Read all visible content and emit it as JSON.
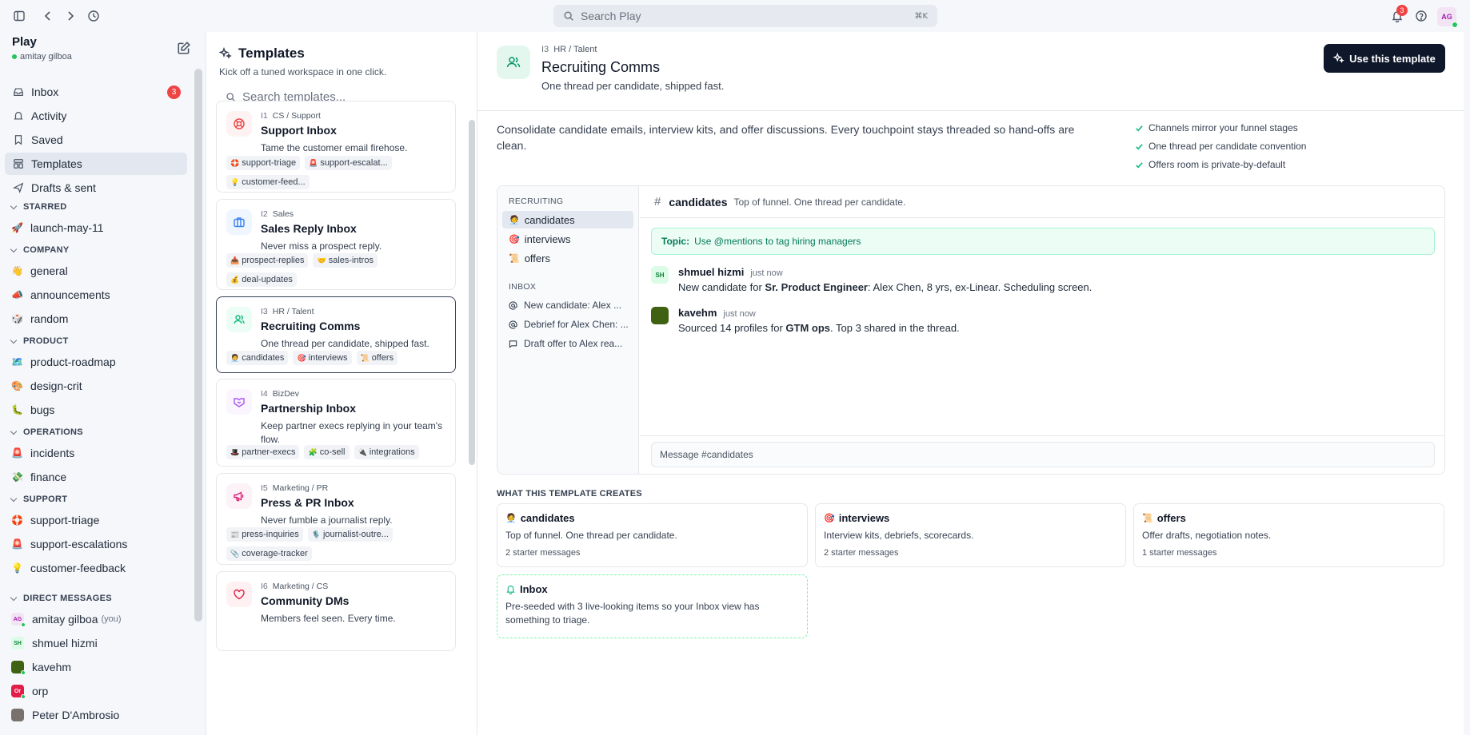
{
  "topbar": {
    "search_placeholder": "Search Play",
    "search_shortcut": "⌘K",
    "notification_count": "3",
    "user_initials": "AG"
  },
  "sidebar": {
    "workspace": "Play",
    "user": "amitay gilboa",
    "nav": [
      {
        "label": "Inbox",
        "icon": "inbox-icon",
        "badge": "3"
      },
      {
        "label": "Activity",
        "icon": "activity-icon"
      },
      {
        "label": "Saved",
        "icon": "bookmark-icon"
      },
      {
        "label": "Templates",
        "icon": "templates-icon"
      },
      {
        "label": "Drafts & sent",
        "icon": "send-icon"
      }
    ],
    "sections": [
      {
        "title": "STARRED",
        "channels": [
          {
            "emoji": "🚀",
            "name": "launch-may-11"
          }
        ]
      },
      {
        "title": "COMPANY",
        "channels": [
          {
            "emoji": "👋",
            "name": "general"
          },
          {
            "emoji": "📣",
            "name": "announcements"
          },
          {
            "emoji": "🎲",
            "name": "random"
          }
        ]
      },
      {
        "title": "PRODUCT",
        "channels": [
          {
            "emoji": "🗺️",
            "name": "product-roadmap"
          },
          {
            "emoji": "🎨",
            "name": "design-crit"
          },
          {
            "emoji": "🐛",
            "name": "bugs"
          }
        ]
      },
      {
        "title": "OPERATIONS",
        "channels": [
          {
            "emoji": "🚨",
            "name": "incidents"
          },
          {
            "emoji": "💸",
            "name": "finance"
          }
        ]
      },
      {
        "title": "SUPPORT",
        "channels": [
          {
            "emoji": "🛟",
            "name": "support-triage"
          },
          {
            "emoji": "🚨",
            "name": "support-escalations"
          },
          {
            "emoji": "💡",
            "name": "customer-feedback"
          }
        ]
      }
    ],
    "dm_title": "DIRECT MESSAGES",
    "dms": [
      {
        "initials": "AG",
        "name": "amitay gilboa",
        "suffix": "(you)",
        "bg": "#f3e4f4",
        "fg": "#a21caf"
      },
      {
        "initials": "SH",
        "name": "shmuel hizmi",
        "suffix": "",
        "bg": "#dcfce7",
        "fg": "#15803d"
      },
      {
        "initials": "",
        "name": "kavehm",
        "suffix": "",
        "bg": "#3f6212",
        "fg": "#fff"
      },
      {
        "initials": "Or",
        "name": "orp",
        "suffix": "",
        "bg": "#e11d48",
        "fg": "#fff"
      },
      {
        "initials": "",
        "name": "Peter D'Ambrosio",
        "suffix": "",
        "bg": "#78716c",
        "fg": "#fff"
      }
    ]
  },
  "templates": {
    "title": "Templates",
    "subtitle": "Kick off a tuned workspace in one click.",
    "search_placeholder": "Search templates...",
    "cards": [
      {
        "num": "I1",
        "cat": "CS / Support",
        "title": "Support Inbox",
        "desc": "Tame the customer email firehose.",
        "icon": "lifebuoy-icon",
        "accent": "#ef4444",
        "tint": "#fef2f2",
        "chips": [
          {
            "e": "🛟",
            "t": "support-triage"
          },
          {
            "e": "🚨",
            "t": "support-escalat..."
          },
          {
            "e": "💡",
            "t": "customer-feed..."
          }
        ]
      },
      {
        "num": "I2",
        "cat": "Sales",
        "title": "Sales Reply Inbox",
        "desc": "Never miss a prospect reply.",
        "icon": "briefcase-icon",
        "accent": "#3b82f6",
        "tint": "#eff6ff",
        "chips": [
          {
            "e": "📥",
            "t": "prospect-replies"
          },
          {
            "e": "🤝",
            "t": "sales-intros"
          },
          {
            "e": "💰",
            "t": "deal-updates"
          }
        ]
      },
      {
        "num": "I3",
        "cat": "HR / Talent",
        "title": "Recruiting Comms",
        "desc": "One thread per candidate, shipped fast.",
        "icon": "users-icon",
        "accent": "#10b981",
        "tint": "#ecfdf5",
        "chips": [
          {
            "e": "🧑‍💼",
            "t": "candidates"
          },
          {
            "e": "🎯",
            "t": "interviews"
          },
          {
            "e": "📜",
            "t": "offers"
          }
        ]
      },
      {
        "num": "I4",
        "cat": "BizDev",
        "title": "Partnership Inbox",
        "desc": "Keep partner execs replying in your team's flow.",
        "icon": "handshake-icon",
        "accent": "#a855f7",
        "tint": "#faf5ff",
        "chips": [
          {
            "e": "🎩",
            "t": "partner-execs"
          },
          {
            "e": "🧩",
            "t": "co-sell"
          },
          {
            "e": "🔌",
            "t": "integrations"
          }
        ]
      },
      {
        "num": "I5",
        "cat": "Marketing / PR",
        "title": "Press & PR Inbox",
        "desc": "Never fumble a journalist reply.",
        "icon": "megaphone-icon",
        "accent": "#db2777",
        "tint": "#fdf2f8",
        "chips": [
          {
            "e": "📰",
            "t": "press-inquiries"
          },
          {
            "e": "🎙️",
            "t": "journalist-outre..."
          },
          {
            "e": "📎",
            "t": "coverage-tracker"
          }
        ]
      },
      {
        "num": "I6",
        "cat": "Marketing / CS",
        "title": "Community DMs",
        "desc": "Members feel seen. Every time.",
        "icon": "heart-icon",
        "accent": "#e11d48",
        "tint": "#fff1f2",
        "chips": []
      }
    ]
  },
  "detail": {
    "num": "I3",
    "category": "HR / Talent",
    "title": "Recruiting Comms",
    "subtitle": "One thread per candidate, shipped fast.",
    "use_button": "Use this template",
    "description": "Consolidate candidate emails, interview kits, and offer discussions. Every touchpoint stays threaded so hand-offs are clean.",
    "checks": [
      "Channels mirror your funnel stages",
      "One thread per candidate convention",
      "Offers room is private-by-default"
    ],
    "preview": {
      "sec1": "RECRUITING",
      "channels": [
        {
          "e": "🧑‍💼",
          "t": "candidates"
        },
        {
          "e": "🎯",
          "t": "interviews"
        },
        {
          "e": "📜",
          "t": "offers"
        }
      ],
      "sec2": "INBOX",
      "inbox": [
        "New candidate: Alex ...",
        "Debrief for Alex Chen: ...",
        "Draft offer to Alex rea..."
      ],
      "channel_name": "candidates",
      "channel_topic": "Top of funnel. One thread per candidate.",
      "topic_label": "Topic:",
      "topic_text": "Use @mentions to tag hiring managers",
      "messages": [
        {
          "initials": "SH",
          "author": "shmuel hizmi",
          "time": "just now",
          "pre": "New candidate for ",
          "bold": "Sr. Product Engineer",
          "post": ": Alex Chen, 8 yrs, ex-Linear. Scheduling screen."
        },
        {
          "initials": "",
          "author": "kavehm",
          "time": "just now",
          "pre": "Sourced 14 profiles for ",
          "bold": "GTM ops",
          "post": ". Top 3 shared in the thread."
        }
      ],
      "composer_placeholder": "Message #candidates"
    },
    "creates_title": "WHAT THIS TEMPLATE CREATES",
    "creates": [
      {
        "e": "🧑‍💼",
        "t": "candidates",
        "d": "Top of funnel. One thread per candidate.",
        "n": "2 starter messages"
      },
      {
        "e": "🎯",
        "t": "interviews",
        "d": "Interview kits, debriefs, scorecards.",
        "n": "2 starter messages"
      },
      {
        "e": "📜",
        "t": "offers",
        "d": "Offer drafts, negotiation notes.",
        "n": "1 starter messages"
      }
    ],
    "inbox_card": {
      "t": "Inbox",
      "d": "Pre-seeded with 3 live-looking items so your Inbox view has something to triage."
    }
  }
}
